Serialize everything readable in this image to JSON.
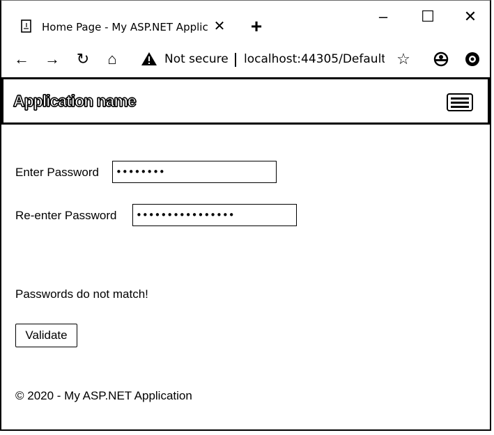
{
  "browser": {
    "tab_title": "Home Page - My ASP.NET Applic",
    "close_tab": "✕",
    "new_tab": "+",
    "win_min": "–",
    "win_max": "☐",
    "win_close": "✕",
    "nav": {
      "back": "←",
      "forward": "→",
      "reload": "↻",
      "home": "⌂"
    },
    "not_secure": "Not secure",
    "url": "localhost:44305/Default",
    "star": "☆",
    "icons": {
      "favicon": "page-icon",
      "warning": "warning-icon",
      "profile": "profile-icon",
      "extension": "extension-icon"
    }
  },
  "app": {
    "brand": "Application name",
    "menu_icon": "hamburger-icon"
  },
  "form": {
    "enter_label": "Enter Password",
    "enter_value": "••••••••",
    "reenter_label": "Re-enter Password",
    "reenter_value": "••••••••••••••••",
    "message": "Passwords do not match!",
    "validate_label": "Validate"
  },
  "footer": {
    "text": "© 2020 - My ASP.NET Application"
  }
}
